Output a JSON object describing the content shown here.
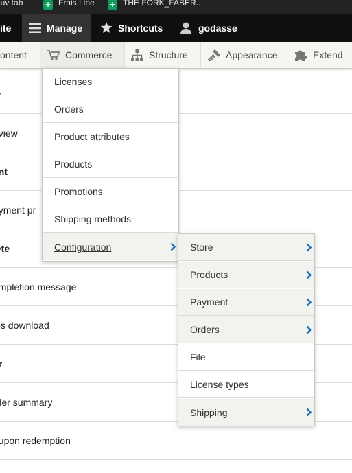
{
  "bookmarks": [
    {
      "label": "sauv tab"
    },
    {
      "label": "Frais Line"
    },
    {
      "label": "THE FORK_FABER..."
    }
  ],
  "toolbar": {
    "site_label": "ite",
    "manage_label": "Manage",
    "shortcuts_label": "Shortcuts",
    "user_label": "godasse"
  },
  "tray": {
    "content_label": "ontent",
    "commerce_label": "Commerce",
    "structure_label": "Structure",
    "appearance_label": "Appearance",
    "extend_label": "Extend"
  },
  "content_rows": [
    "w",
    "eview",
    "ent",
    "ayment pr",
    "lete",
    "ompletion message",
    "les download",
    "ar",
    "rder summary",
    "oupon redemption"
  ],
  "commerce_menu": {
    "items": [
      {
        "label": "Licenses"
      },
      {
        "label": "Orders"
      },
      {
        "label": "Product attributes"
      },
      {
        "label": "Products"
      },
      {
        "label": "Promotions"
      },
      {
        "label": "Shipping methods"
      },
      {
        "label": "Configuration"
      }
    ]
  },
  "configuration_menu": {
    "items": [
      {
        "label": "Store"
      },
      {
        "label": "Products"
      },
      {
        "label": "Payment"
      },
      {
        "label": "Orders"
      },
      {
        "label": "File"
      },
      {
        "label": "License types"
      },
      {
        "label": "Shipping"
      }
    ]
  },
  "colors": {
    "toolbar_bg": "#0f0f0f",
    "tray_bg": "#f5f5f2",
    "chevron_blue": "#1a6fb6",
    "favicon_green": "#0f9d58"
  }
}
